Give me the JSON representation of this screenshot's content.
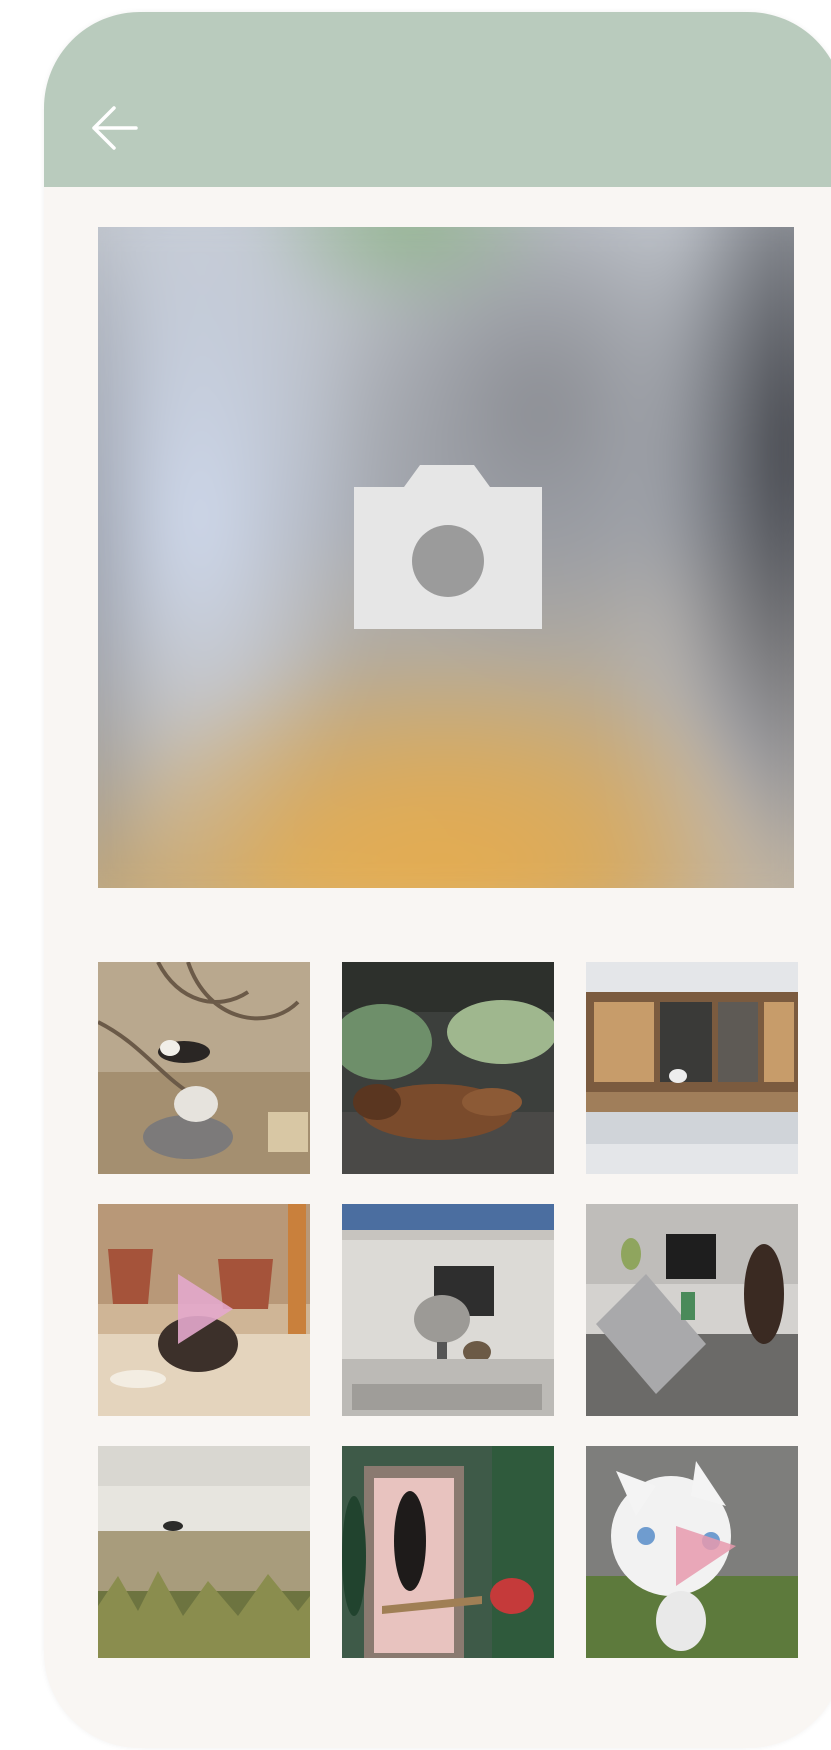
{
  "header": {
    "back_icon": "arrow-left-icon",
    "background_color": "#b9cbbd"
  },
  "camera": {
    "icon": "camera-icon"
  },
  "gallery": {
    "thumbnails": [
      {
        "icon": "image-thumbnail"
      },
      {
        "icon": "image-thumbnail"
      },
      {
        "icon": "image-thumbnail"
      },
      {
        "icon": "image-thumbnail"
      },
      {
        "icon": "image-thumbnail"
      },
      {
        "icon": "image-thumbnail"
      },
      {
        "icon": "image-thumbnail"
      },
      {
        "icon": "image-thumbnail"
      },
      {
        "icon": "image-thumbnail"
      }
    ]
  }
}
